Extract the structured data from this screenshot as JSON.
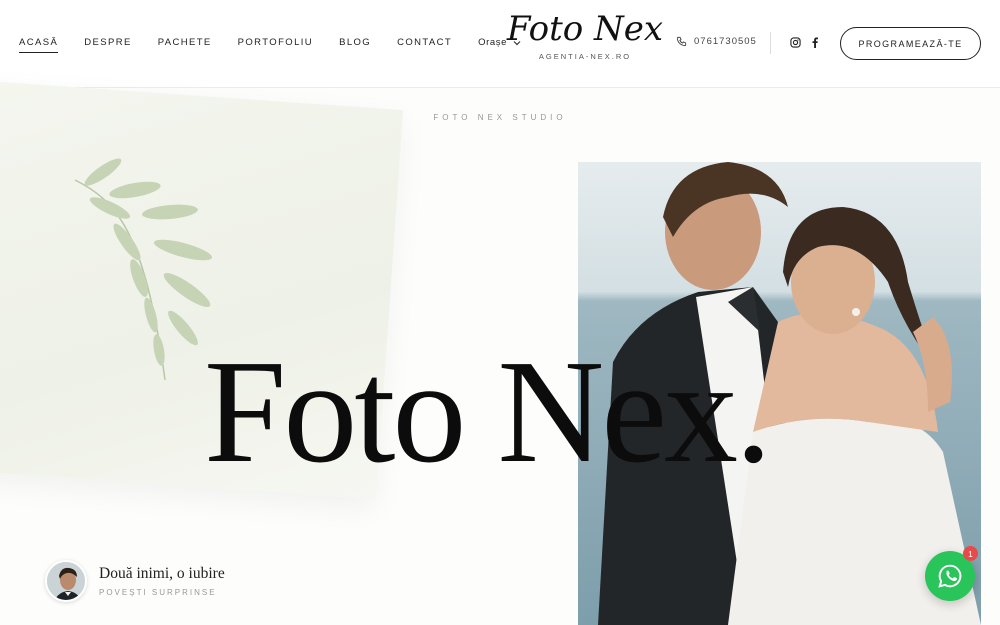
{
  "nav": {
    "items": [
      {
        "label": "ACASĂ",
        "active": true
      },
      {
        "label": "DESPRE"
      },
      {
        "label": "PACHETE"
      },
      {
        "label": "PORTOFOLIU"
      },
      {
        "label": "BLOG"
      },
      {
        "label": "CONTACT"
      }
    ],
    "cities_label": "Orașe"
  },
  "logo": {
    "brand": "Foto Nex",
    "subtitle": "AGENTIA-NEX.RO"
  },
  "contact": {
    "phone": "0761730505"
  },
  "social": {
    "icons": [
      "instagram-icon",
      "facebook-icon"
    ]
  },
  "cta": {
    "label": "PROGRAMEAZĂ-TE"
  },
  "hero": {
    "kicker": "FOTO NEX STUDIO",
    "title": "Foto Nex."
  },
  "story": {
    "title": "Două inimi, o iubire",
    "subtitle": "POVEȘTI SURPRINSE"
  },
  "whatsapp": {
    "badge_count": "1"
  },
  "colors": {
    "whatsapp": "#29c55a",
    "badge": "#e84a4a",
    "text": "#0c0c0c"
  }
}
